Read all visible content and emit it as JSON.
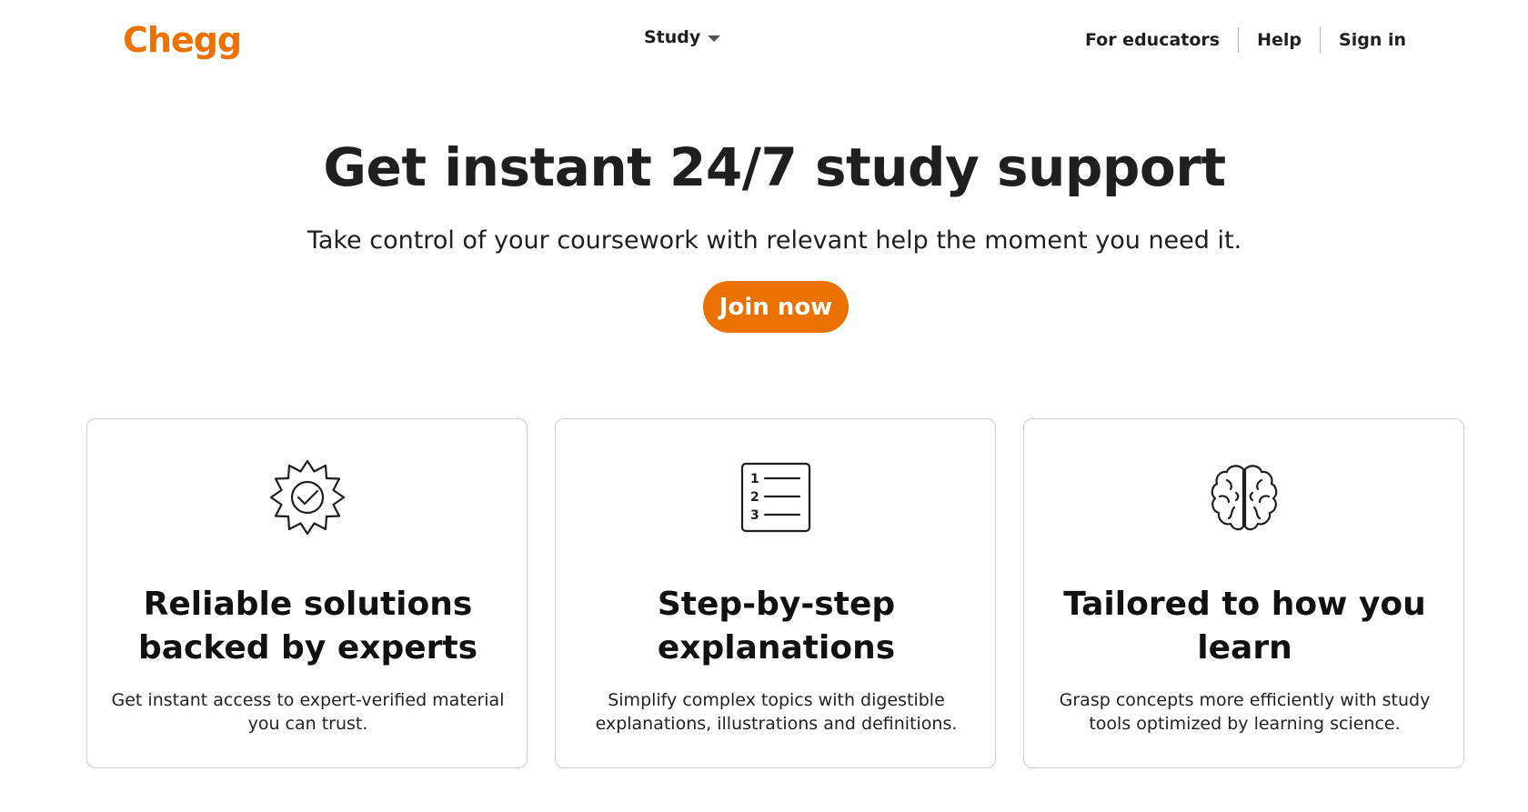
{
  "header": {
    "logo_text": "Chegg",
    "study_label": "Study",
    "nav": [
      {
        "label": "For educators"
      },
      {
        "label": "Help"
      },
      {
        "label": "Sign in"
      }
    ]
  },
  "hero": {
    "title": "Get instant 24/7 study support",
    "subtitle": "Take control of your coursework with relevant help the moment you need it.",
    "cta_label": "Join now"
  },
  "cards": [
    {
      "icon": "verified-badge-icon",
      "title": "Reliable solutions backed by experts",
      "text": "Get instant access to expert-verified material you can trust."
    },
    {
      "icon": "numbered-list-icon",
      "title": "Step-by-step explanations",
      "text": "Simplify complex topics with digestible explanations, illustrations and definitions."
    },
    {
      "icon": "brain-icon",
      "title": "Tailored to how you learn",
      "text": "Grasp concepts more efficiently with study tools optimized by learning science."
    }
  ],
  "colors": {
    "brand_orange": "#eb7100",
    "text": "#1f1f1f",
    "card_border": "#cfcfcf"
  }
}
